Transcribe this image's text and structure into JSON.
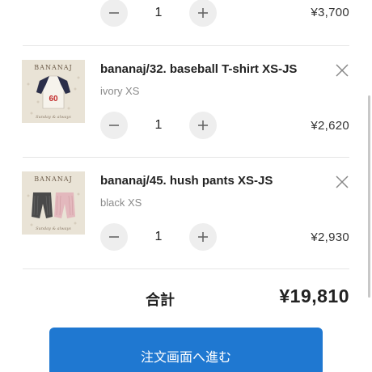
{
  "cart": {
    "items": [
      {
        "quantity": "1",
        "price": "¥3,700",
        "minus_icon": "minus-icon",
        "plus_icon": "plus-icon"
      },
      {
        "name": "bananaj/32. baseball T-shirt XS-JS",
        "variant": "ivory XS",
        "quantity": "1",
        "price": "¥2,620",
        "thumb_brand": "BANANAJ",
        "thumb_number": "60",
        "thumb_script": "Sunday & always",
        "remove_icon": "close-icon"
      },
      {
        "name": "bananaj/45. hush pants XS-JS",
        "variant": "black XS",
        "quantity": "1",
        "price": "¥2,930",
        "thumb_brand": "BANANAJ",
        "thumb_script": "Sunday & always",
        "remove_icon": "close-icon"
      }
    ],
    "total_label": "合計",
    "total_value": "¥19,810",
    "checkout_label": "注文画面へ進む"
  },
  "colors": {
    "accent": "#1f78d1",
    "button_bg": "#eeeeee",
    "muted_text": "#8a8a8a"
  }
}
